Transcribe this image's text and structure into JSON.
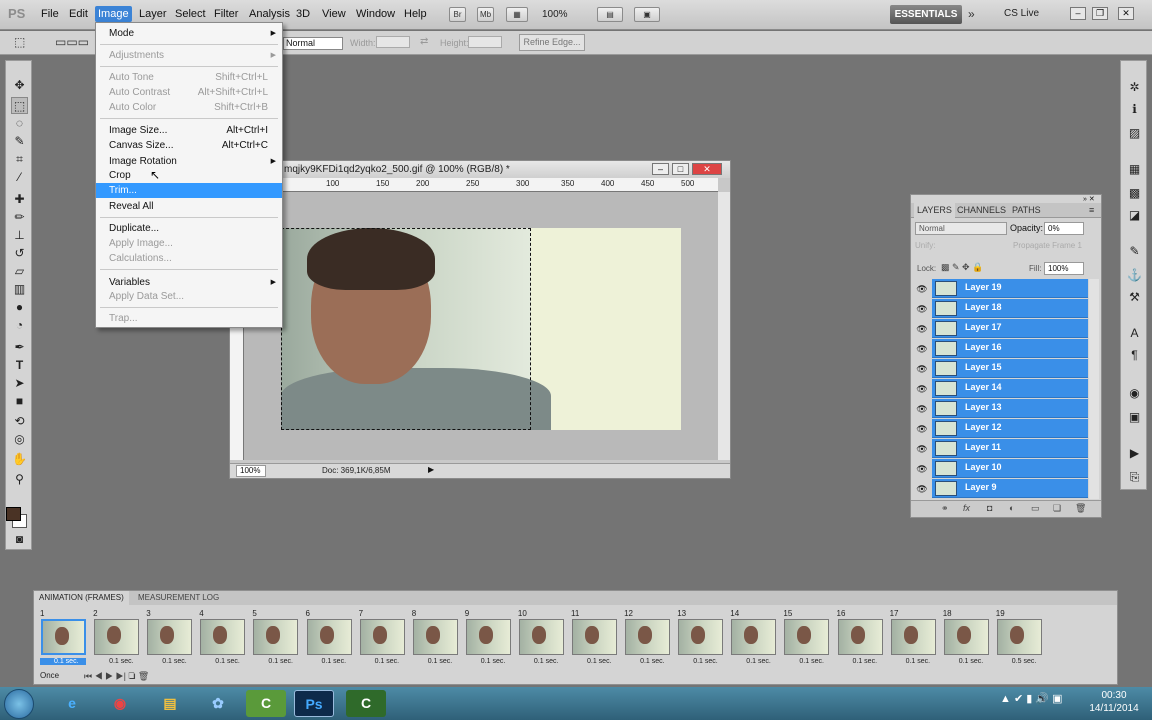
{
  "menubar": {
    "logo": "PS",
    "items": [
      "File",
      "Edit",
      "Image",
      "Layer",
      "Select",
      "Filter",
      "Analysis",
      "3D",
      "View",
      "Window",
      "Help"
    ],
    "zoom": "100%",
    "workspace": "ESSENTIALS",
    "cs_live": "CS Live"
  },
  "options_bar": {
    "style": "Normal",
    "width_label": "Width:",
    "height_label": "Height:",
    "refine_edge": "Refine Edge..."
  },
  "image_menu": {
    "mode": "Mode",
    "adjustments": "Adjustments",
    "auto_tone": "Auto Tone",
    "auto_tone_sc": "Shift+Ctrl+L",
    "auto_contrast": "Auto Contrast",
    "auto_contrast_sc": "Alt+Shift+Ctrl+L",
    "auto_color": "Auto Color",
    "auto_color_sc": "Shift+Ctrl+B",
    "image_size": "Image Size...",
    "image_size_sc": "Alt+Ctrl+I",
    "canvas_size": "Canvas Size...",
    "canvas_size_sc": "Alt+Ctrl+C",
    "image_rotation": "Image Rotation",
    "crop": "Crop",
    "trim": "Trim...",
    "reveal_all": "Reveal All",
    "duplicate": "Duplicate...",
    "apply_image": "Apply Image...",
    "calculations": "Calculations...",
    "variables": "Variables",
    "apply_data_set": "Apply Data Set...",
    "trap": "Trap..."
  },
  "document": {
    "title": "mqjky9KFDi1qd2yqko2_500.gif @ 100% (RGB/8) *",
    "ruler_ticks": [
      "100",
      "150",
      "200",
      "250",
      "300",
      "350",
      "400",
      "450",
      "500"
    ],
    "zoom": "100%",
    "doc_info": "Doc: 369,1K/6,85M"
  },
  "layers_panel": {
    "tabs": [
      "LAYERS",
      "CHANNELS",
      "PATHS"
    ],
    "blend_mode": "Normal",
    "opacity_label": "Opacity:",
    "opacity": "0%",
    "unify_label": "Unify:",
    "propagate_label": "Propagate Frame 1",
    "lock_label": "Lock:",
    "fill_label": "Fill:",
    "fill": "100%",
    "layers": [
      "Layer 19",
      "Layer 18",
      "Layer 17",
      "Layer 16",
      "Layer 15",
      "Layer 14",
      "Layer 13",
      "Layer 12",
      "Layer 11",
      "Layer 10",
      "Layer 9"
    ]
  },
  "animation_panel": {
    "tabs": [
      "ANIMATION (FRAMES)",
      "MEASUREMENT LOG"
    ],
    "frames": [
      {
        "num": "1",
        "delay": "0.1 sec."
      },
      {
        "num": "2",
        "delay": "0.1 sec."
      },
      {
        "num": "3",
        "delay": "0.1 sec."
      },
      {
        "num": "4",
        "delay": "0.1 sec."
      },
      {
        "num": "5",
        "delay": "0.1 sec."
      },
      {
        "num": "6",
        "delay": "0.1 sec."
      },
      {
        "num": "7",
        "delay": "0.1 sec."
      },
      {
        "num": "8",
        "delay": "0.1 sec."
      },
      {
        "num": "9",
        "delay": "0.1 sec."
      },
      {
        "num": "10",
        "delay": "0.1 sec."
      },
      {
        "num": "11",
        "delay": "0.1 sec."
      },
      {
        "num": "12",
        "delay": "0.1 sec."
      },
      {
        "num": "13",
        "delay": "0.1 sec."
      },
      {
        "num": "14",
        "delay": "0.1 sec."
      },
      {
        "num": "15",
        "delay": "0.1 sec."
      },
      {
        "num": "16",
        "delay": "0.1 sec."
      },
      {
        "num": "17",
        "delay": "0.1 sec."
      },
      {
        "num": "18",
        "delay": "0.1 sec."
      },
      {
        "num": "19",
        "delay": "0.5 sec."
      }
    ],
    "loop": "Once"
  },
  "taskbar": {
    "time": "00:30",
    "date": "14/11/2014"
  },
  "colors": {
    "accent": "#3399ff",
    "layer_selected": "#3a8fe8",
    "foreground": "#4a3325",
    "background": "#ffffff"
  }
}
